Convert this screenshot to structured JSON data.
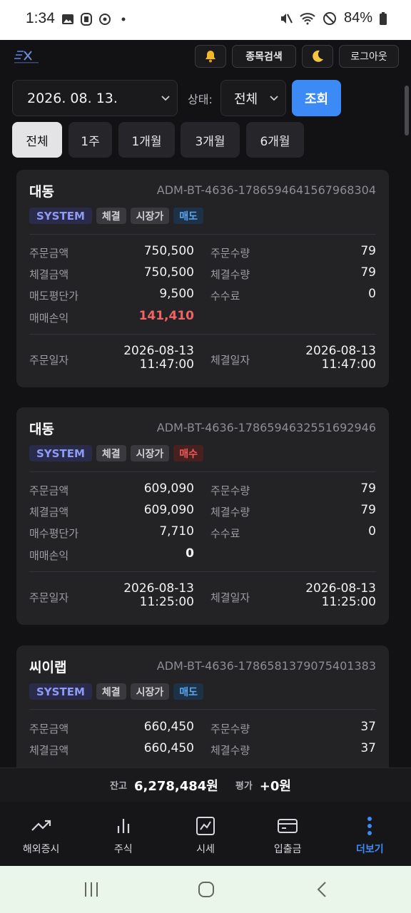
{
  "status_bar": {
    "time": "1:34",
    "battery": "84%"
  },
  "header": {
    "stock_search_label": "종목검색",
    "logout_label": "로그아웃"
  },
  "filters": {
    "date": "2026. 08. 13.",
    "state_label": "상태:",
    "state_value": "전체",
    "query_label": "조회",
    "periods": [
      "전체",
      "1주",
      "1개월",
      "3개월",
      "6개월"
    ],
    "active_period": "전체"
  },
  "labels": {
    "order_amount": "주문금액",
    "exec_amount": "체결금액",
    "order_qty": "주문수량",
    "exec_qty": "체결수량",
    "fee": "수수료",
    "pnl": "매매손익",
    "order_date": "주문일자",
    "exec_date": "체결일자"
  },
  "orders": [
    {
      "stock": "대동",
      "order_id": "ADM-BT-4636-1786594641567968304",
      "badges": [
        "SYSTEM",
        "체결",
        "시장가",
        "매도"
      ],
      "side": "sell",
      "order_amount": "750,500",
      "exec_amount": "750,500",
      "avg_price_label": "매도평단가",
      "avg_price": "9,500",
      "order_qty": "79",
      "exec_qty": "79",
      "fee": "0",
      "pnl": "141,410",
      "order_date": "2026-08-13",
      "order_time": "11:47:00",
      "exec_date": "2026-08-13",
      "exec_time": "11:47:00"
    },
    {
      "stock": "대동",
      "order_id": "ADM-BT-4636-1786594632551692946",
      "badges": [
        "SYSTEM",
        "체결",
        "시장가",
        "매수"
      ],
      "side": "buy",
      "order_amount": "609,090",
      "exec_amount": "609,090",
      "avg_price_label": "매수평단가",
      "avg_price": "7,710",
      "order_qty": "79",
      "exec_qty": "79",
      "fee": "0",
      "pnl": "0",
      "order_date": "2026-08-13",
      "order_time": "11:25:00",
      "exec_date": "2026-08-13",
      "exec_time": "11:25:00"
    },
    {
      "stock": "씨이랩",
      "order_id": "ADM-BT-4636-1786581379075401383",
      "badges": [
        "SYSTEM",
        "체결",
        "시장가",
        "매도"
      ],
      "side": "sell",
      "order_amount": "660,450",
      "exec_amount": "660,450",
      "order_qty": "37",
      "exec_qty": "37"
    }
  ],
  "summary": {
    "balance_label": "잔고",
    "balance": "6,278,484원",
    "eval_label": "평가",
    "eval": "+0원"
  },
  "bottom_nav": [
    "해외증시",
    "주식",
    "시세",
    "입출금",
    "더보기"
  ],
  "colors": {
    "accent": "#3b8af6",
    "sell": "#5ba5f0",
    "buy": "#ee5a5a",
    "profit": "#f06464"
  }
}
